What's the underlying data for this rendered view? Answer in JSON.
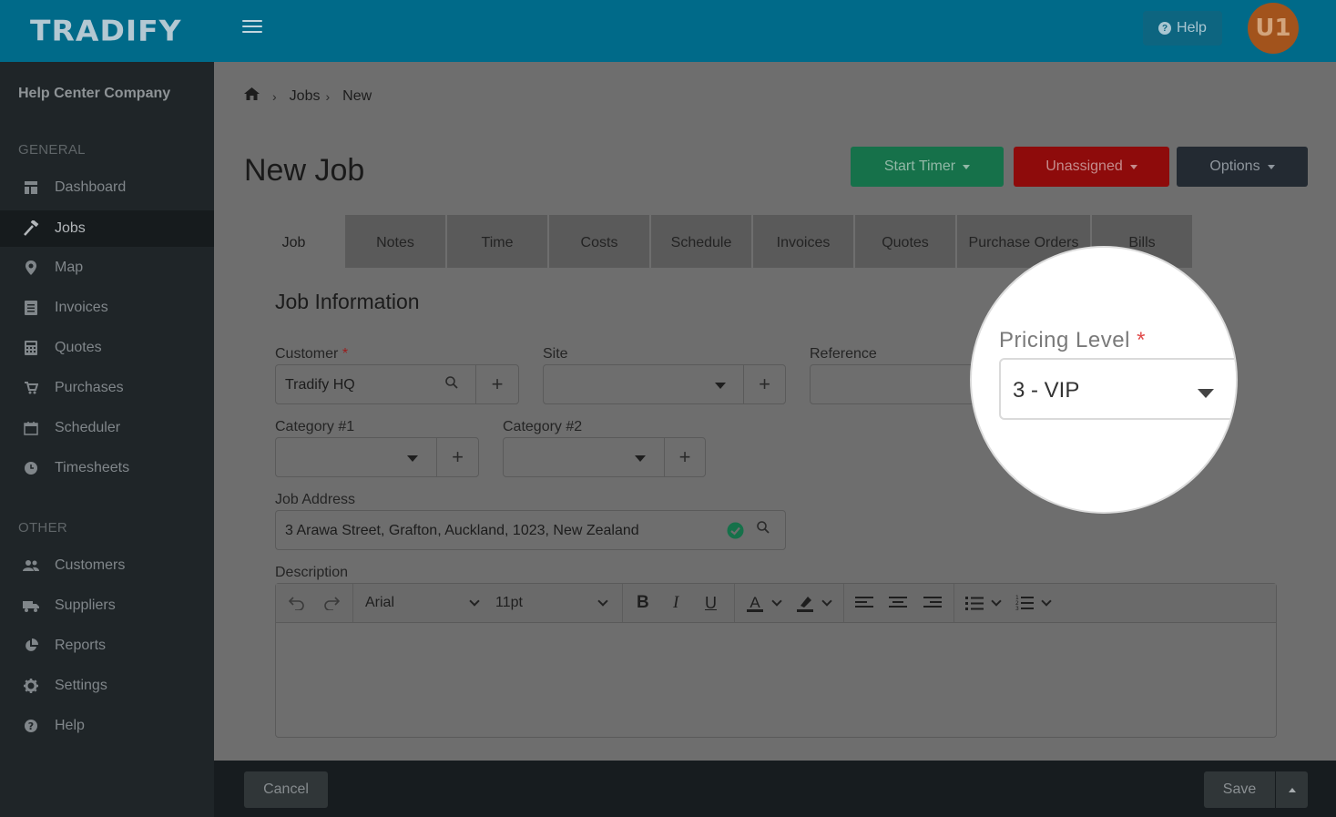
{
  "topbar": {
    "logo": "TRADIFY",
    "help_label": "Help",
    "avatar_initials": "U1"
  },
  "sidebar": {
    "company": "Help Center Company",
    "general_heading": "GENERAL",
    "other_heading": "OTHER",
    "general_items": [
      {
        "label": "Dashboard",
        "icon": "dashboard-icon"
      },
      {
        "label": "Jobs",
        "icon": "hammer-icon",
        "active": true
      },
      {
        "label": "Map",
        "icon": "map-pin-icon"
      },
      {
        "label": "Invoices",
        "icon": "invoice-icon"
      },
      {
        "label": "Quotes",
        "icon": "calculator-icon"
      },
      {
        "label": "Purchases",
        "icon": "cart-icon"
      },
      {
        "label": "Scheduler",
        "icon": "calendar-icon"
      },
      {
        "label": "Timesheets",
        "icon": "clock-icon"
      }
    ],
    "other_items": [
      {
        "label": "Customers",
        "icon": "users-icon"
      },
      {
        "label": "Suppliers",
        "icon": "truck-icon"
      },
      {
        "label": "Reports",
        "icon": "pie-chart-icon"
      },
      {
        "label": "Settings",
        "icon": "gear-icon"
      },
      {
        "label": "Help",
        "icon": "question-icon"
      }
    ]
  },
  "breadcrumb": {
    "jobs": "Jobs",
    "current": "New"
  },
  "page": {
    "title": "New Job"
  },
  "header_buttons": {
    "start_timer": "Start Timer",
    "unassigned": "Unassigned",
    "options": "Options"
  },
  "tabs": [
    "Job",
    "Notes",
    "Time",
    "Costs",
    "Schedule",
    "Invoices",
    "Quotes",
    "Purchase Orders",
    "Bills"
  ],
  "form": {
    "section_title": "Job Information",
    "customer_label": "Customer",
    "customer_value": "Tradify HQ",
    "site_label": "Site",
    "reference_label": "Reference",
    "category1_label": "Category #1",
    "category2_label": "Category #2",
    "address_label": "Job Address",
    "address_value": "3 Arawa Street, Grafton, Auckland, 1023, New Zealand",
    "description_label": "Description",
    "required_mark": "*"
  },
  "editor": {
    "font": "Arial",
    "size": "11pt"
  },
  "magnifier": {
    "label": "Pricing Level",
    "required_mark": "*",
    "value": "3 - VIP"
  },
  "footer": {
    "cancel": "Cancel",
    "save": "Save"
  }
}
